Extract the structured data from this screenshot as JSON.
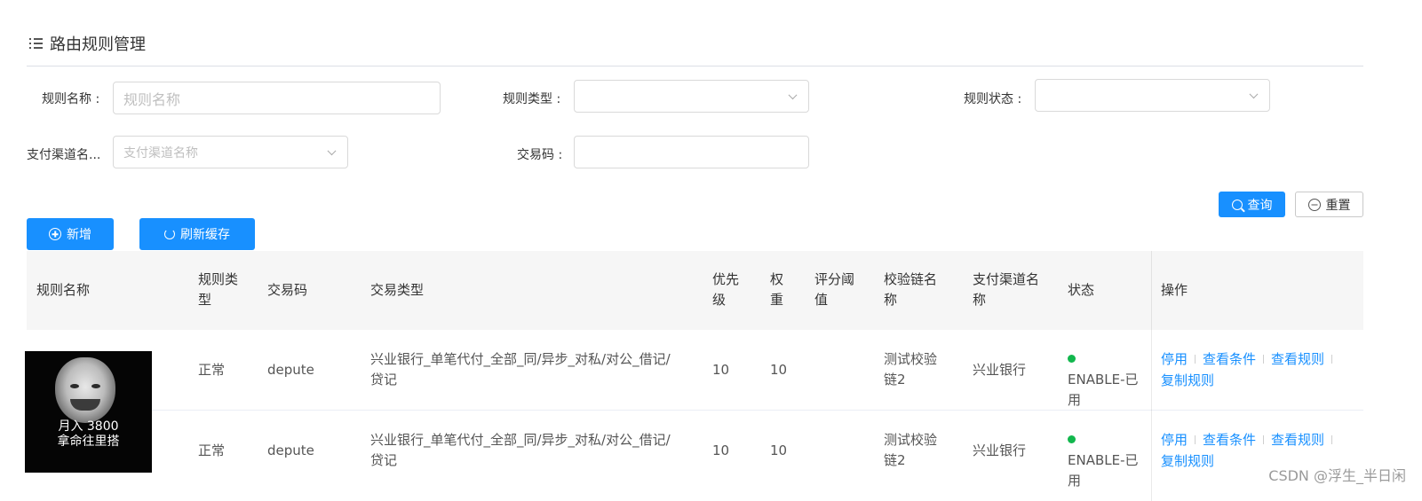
{
  "page": {
    "title": "路由规则管理"
  },
  "form": {
    "rule_name": {
      "label": "规则名称 :",
      "placeholder": "规则名称"
    },
    "rule_type": {
      "label": "规则类型 :"
    },
    "rule_status": {
      "label": "规则状态 :"
    },
    "channel_name": {
      "label": "支付渠道名...",
      "placeholder": "支付渠道名称"
    },
    "trade_code": {
      "label": "交易码 :"
    }
  },
  "buttons": {
    "query": "查询",
    "reset": "重置",
    "add": "新增",
    "refresh_cache": "刷新缓存"
  },
  "table": {
    "columns": [
      "规则名称",
      "规则类\n型",
      "交易码",
      "交易类型",
      "优先\n级",
      "权\n重",
      "评分阈\n值",
      "校验链名\n称",
      "支付渠道名\n称",
      "状态",
      "操作"
    ],
    "rows": [
      {
        "rule_name": "",
        "rule_type": "正常",
        "trade_code": "depute",
        "trade_type": "兴业银行_单笔代付_全部_同/异步_对私/对公_借记/\n贷记",
        "priority": "10",
        "weight": "10",
        "threshold": "",
        "chain_name": "测试校验\n链2",
        "channel": "兴业银行",
        "status": "ENABLE-已\n用",
        "status_color": "#12b74d"
      },
      {
        "rule_name": "",
        "rule_type": "正常",
        "trade_code": "depute",
        "trade_type": "兴业银行_单笔代付_全部_同/异步_对私/对公_借记/\n贷记",
        "priority": "10",
        "weight": "10",
        "threshold": "",
        "chain_name": "测试校验\n链2",
        "channel": "兴业银行",
        "status": "ENABLE-已\n用",
        "status_color": "#12b74d"
      }
    ],
    "actions": [
      "停用",
      "查看条件",
      "查看规则",
      "复制规则"
    ]
  },
  "overlay": {
    "meme_line1": "月入 3800",
    "meme_line2": "拿命往里搭"
  },
  "watermark": "CSDN @浮生_半日闲",
  "colors": {
    "primary": "#1890ff",
    "status_enable": "#12b74d"
  }
}
